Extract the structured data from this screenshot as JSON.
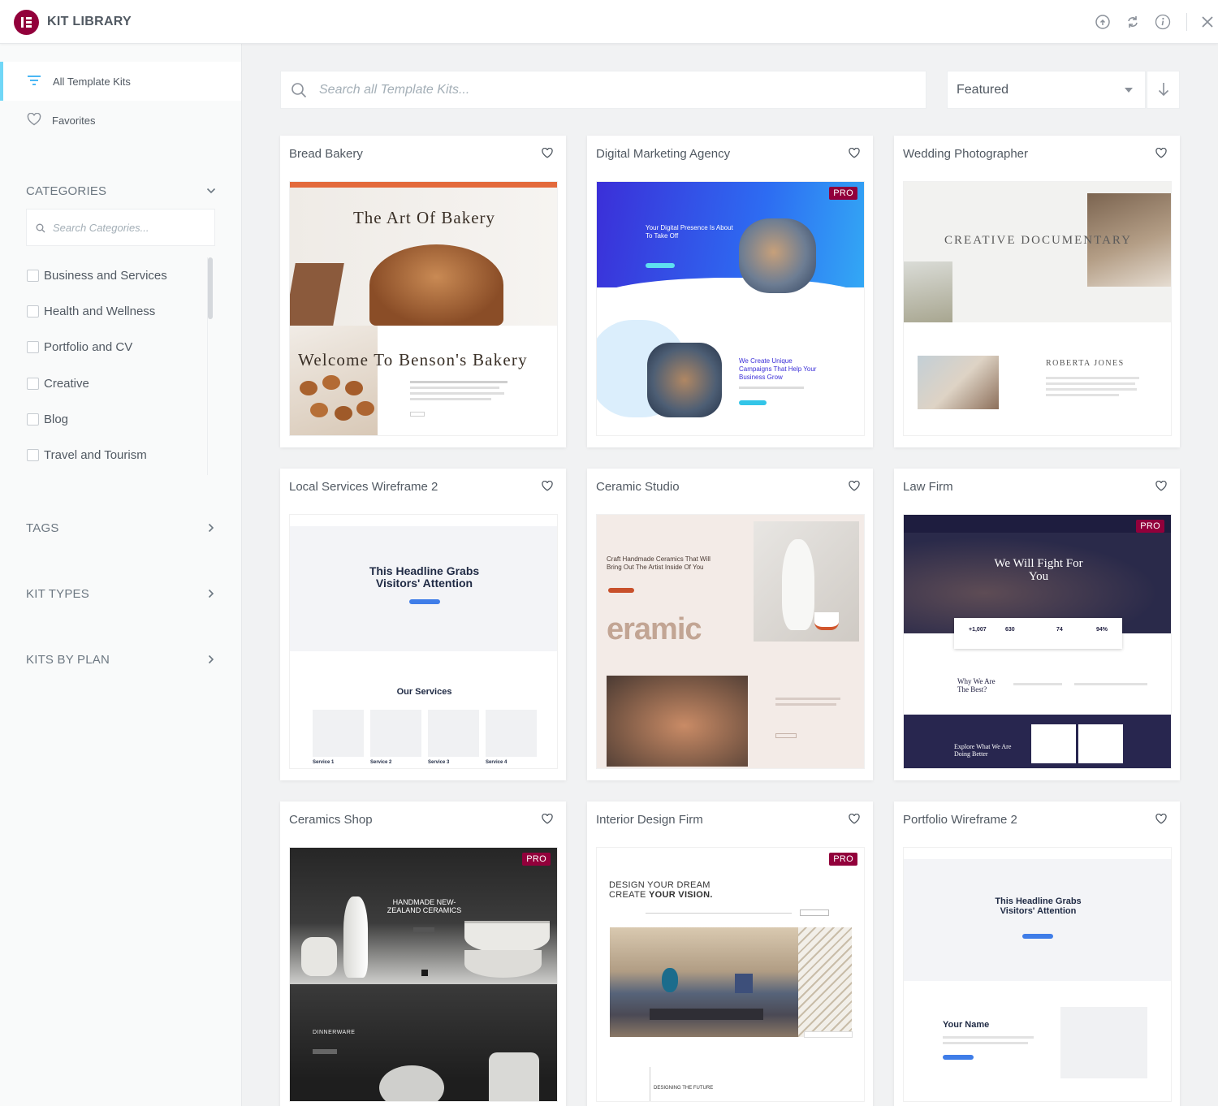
{
  "header": {
    "title": "KIT LIBRARY",
    "icons": [
      "info-circle-icon",
      "sync-icon",
      "info-icon",
      "close-icon"
    ]
  },
  "sidebar": {
    "nav": [
      {
        "label": "All Template Kits",
        "icon": "filter-icon",
        "active": true
      },
      {
        "label": "Favorites",
        "icon": "heart-icon",
        "active": false
      }
    ],
    "categories": {
      "title": "CATEGORIES",
      "search_placeholder": "Search Categories...",
      "items": [
        "Business and Services",
        "Health and Wellness",
        "Portfolio and CV",
        "Creative",
        "Blog",
        "Travel and Tourism"
      ]
    },
    "sections": [
      "TAGS",
      "KIT TYPES",
      "KITS BY PLAN"
    ]
  },
  "toolbar": {
    "search_placeholder": "Search all Template Kits...",
    "sort_value": "Featured"
  },
  "badge_label": "PRO",
  "colors": {
    "accent": "#92003b",
    "active_bar": "#71d7f7",
    "text": "#515962"
  },
  "kits": [
    {
      "title": "Bread Bakery",
      "pro": false,
      "preview": {
        "h1": "The Art Of Bakery",
        "h2": "Welcome To Benson's Bakery"
      }
    },
    {
      "title": "Digital Marketing Agency",
      "pro": true,
      "preview": {
        "h1": "Your Digital Presence Is About To Take Off",
        "h2": "We Create Unique Campaigns That Help Your Business Grow"
      }
    },
    {
      "title": "Wedding Photographer",
      "pro": false,
      "preview": {
        "h1": "CREATIVE DOCUMENTARY",
        "h2": "ROBERTA JONES"
      }
    },
    {
      "title": "Local Services Wireframe 2",
      "pro": false,
      "preview": {
        "h1": "This Headline Grabs Visitors' Attention",
        "h2": "Our Services",
        "services": [
          "Service 1",
          "Service 2",
          "Service 3",
          "Service 4"
        ]
      }
    },
    {
      "title": "Ceramic Studio",
      "pro": false,
      "preview": {
        "h1": "Craft Handmade Ceramics That Will Bring Out The Artist Inside Of You",
        "h2": "eramic"
      }
    },
    {
      "title": "Law Firm",
      "pro": true,
      "preview": {
        "h1": "We Will Fight For You",
        "h2": "Why We Are The Best?",
        "h3": "Explore What We Are Doing Better",
        "stats": [
          "+1,007",
          "630",
          "74",
          "94%"
        ]
      }
    },
    {
      "title": "Ceramics Shop",
      "pro": true,
      "preview": {
        "h1": "HANDMADE NEW-ZEALAND CERAMICS",
        "h2": "DINNERWARE"
      }
    },
    {
      "title": "Interior Design Firm",
      "pro": true,
      "preview": {
        "h1": "DESIGN YOUR DREAM",
        "h1b": "CREATE",
        "h1c": "YOUR VISION.",
        "h2": "DESIGNING THE FUTURE"
      }
    },
    {
      "title": "Portfolio Wireframe 2",
      "pro": false,
      "preview": {
        "h1": "This Headline Grabs Visitors' Attention",
        "h2": "Your Name"
      }
    }
  ]
}
